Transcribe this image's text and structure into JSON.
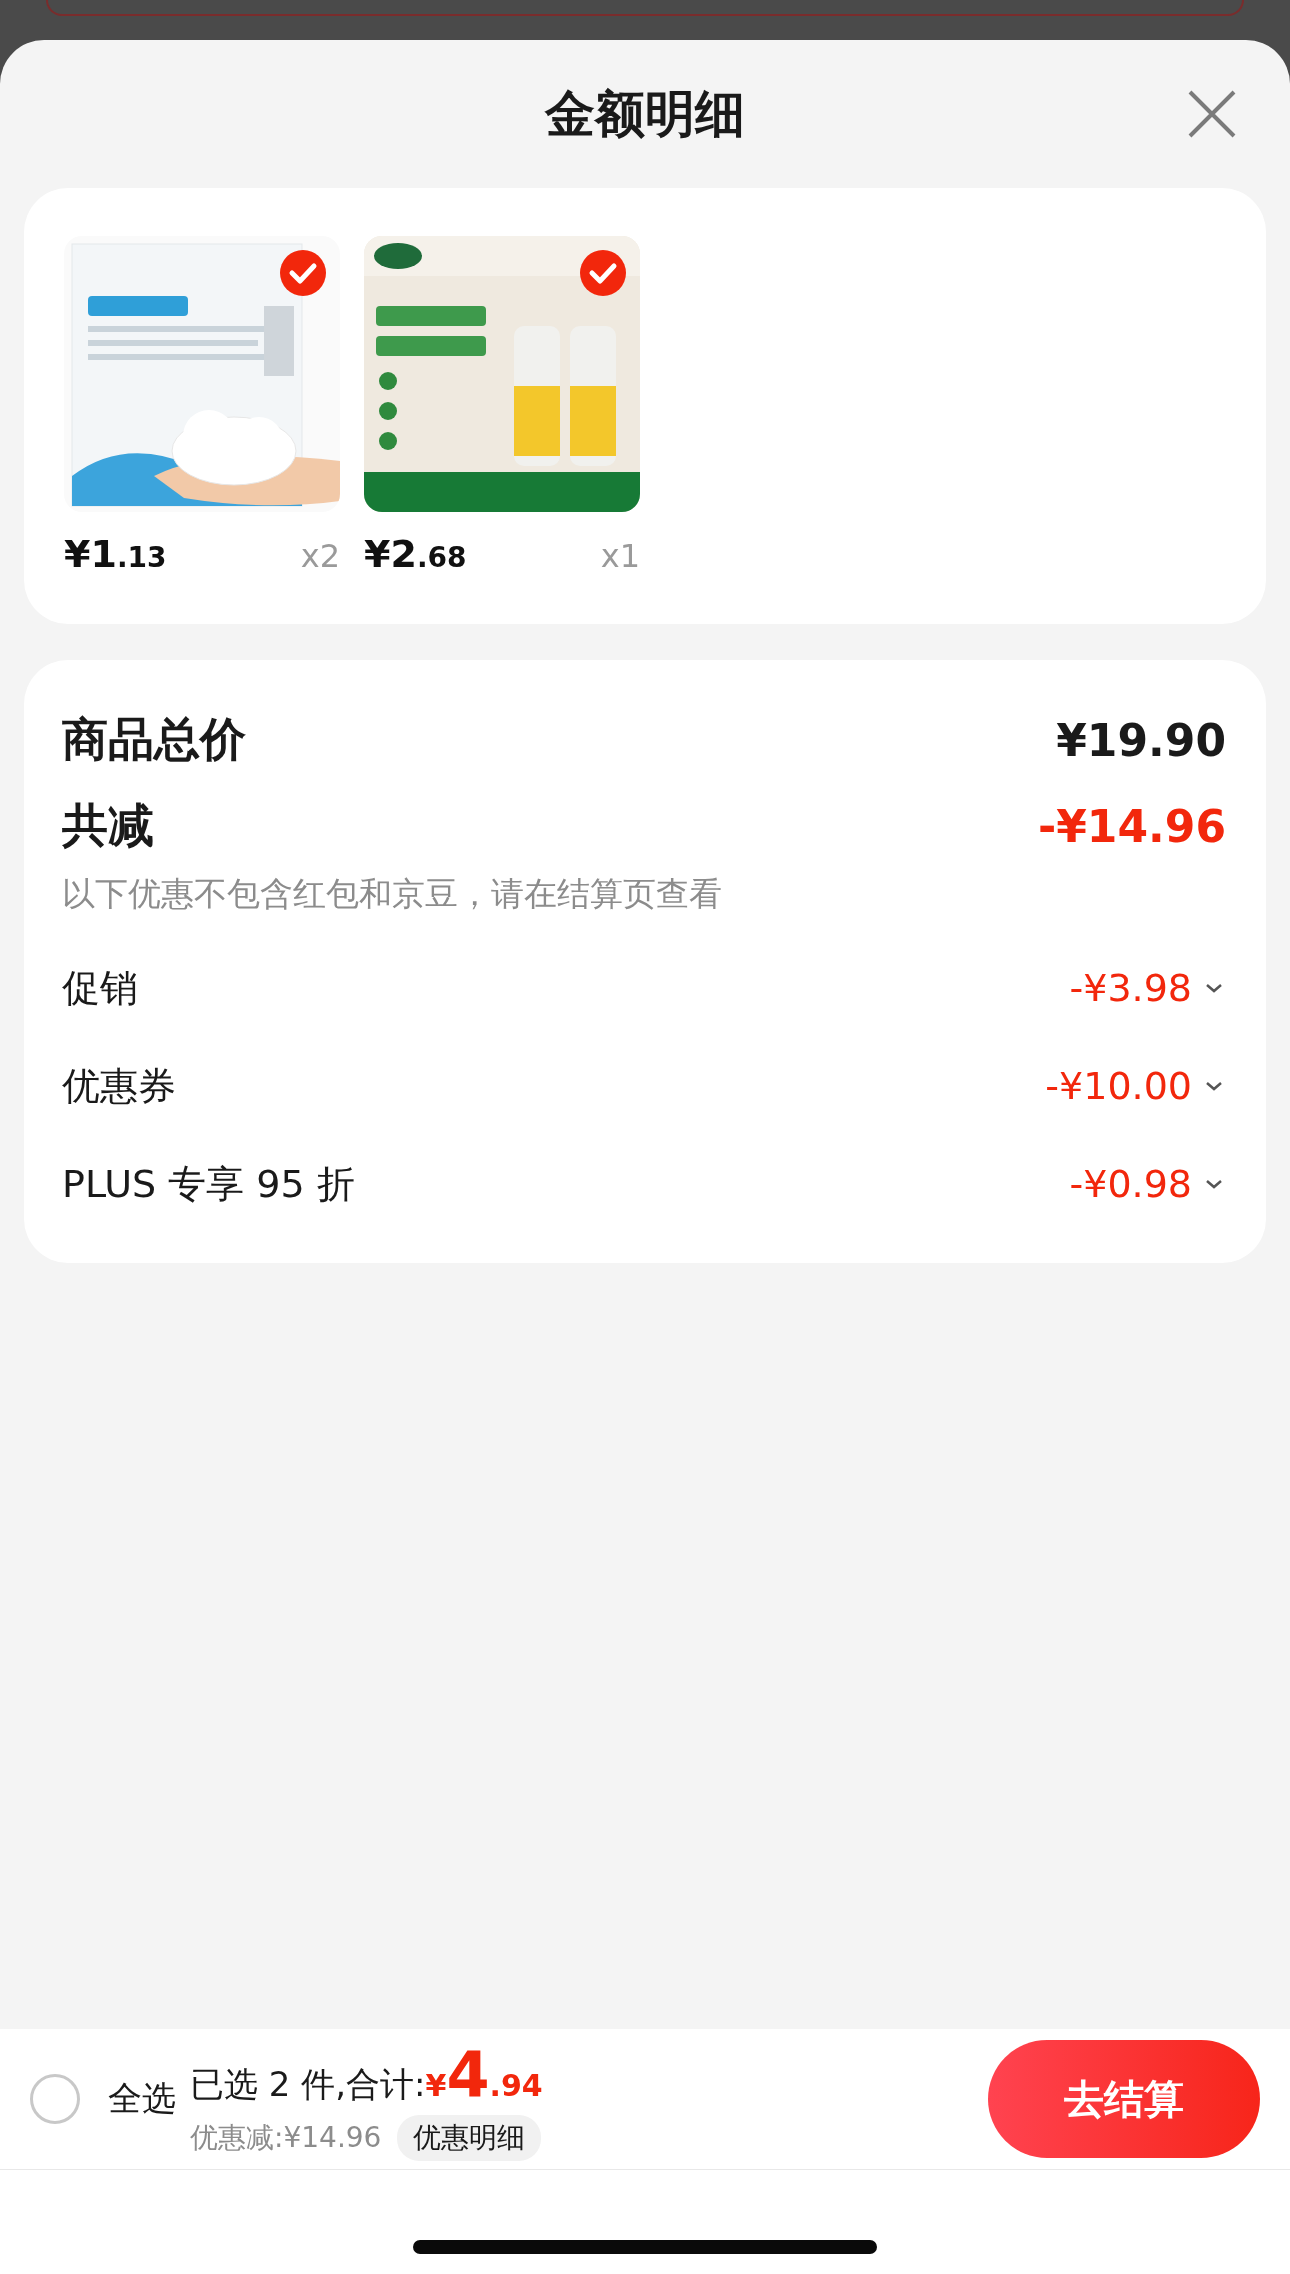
{
  "title": "金额明细",
  "products": [
    {
      "kind": "picture",
      "price_main": "¥1",
      "price_cents": ".13",
      "quantity": "x2",
      "checked": true
    },
    {
      "kind": "picture",
      "price_main": "¥2",
      "price_cents": ".68",
      "quantity": "x1",
      "checked": true
    }
  ],
  "summary": {
    "total": {
      "label": "商品总价",
      "value": "¥19.90"
    },
    "discount": {
      "label": "共减",
      "value": "-¥14.96",
      "note": "以下优惠不包含红包和京豆，请在结算页查看"
    },
    "items": [
      {
        "label": "促销",
        "value": "-¥3.98"
      },
      {
        "label": "优惠券",
        "value": "-¥10.00"
      },
      {
        "label": "PLUS 专享 95 折",
        "value": "-¥0.98"
      }
    ]
  },
  "footer": {
    "select_all": {
      "label": "全选",
      "checked": false
    },
    "selected_text": "已选 2 件,合计:",
    "currency": "¥",
    "amount_main": "4",
    "amount_cents": ".94",
    "saved": "优惠减:¥14.96",
    "details_button": "优惠明细",
    "checkout_button": "去结算"
  }
}
